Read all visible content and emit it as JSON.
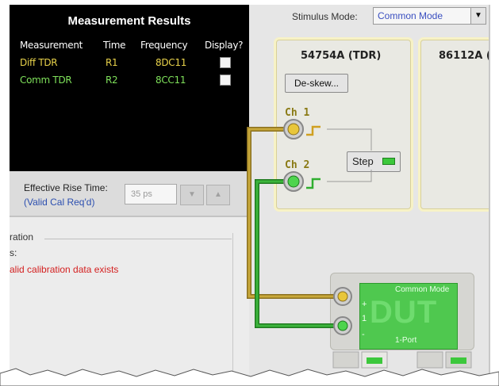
{
  "results": {
    "title": "Measurement Results",
    "headers": [
      "Measurement",
      "Time",
      "Frequency",
      "Display?"
    ],
    "rows": [
      {
        "measurement": "Diff TDR",
        "time": "R1",
        "frequency": "8DC11",
        "display": false
      },
      {
        "measurement": "Comm TDR",
        "time": "R2",
        "frequency": "8CC11",
        "display": false
      }
    ]
  },
  "rise": {
    "label": "Effective Rise Time:",
    "note": "(Valid Cal Req'd)",
    "value": "35 ps"
  },
  "calibration": {
    "title": "ration",
    "status_label": "s:",
    "message": "alid calibration data exists"
  },
  "stimulus": {
    "label": "Stimulus Mode:",
    "value": "Common Mode"
  },
  "instruments": {
    "module1": "54754A (TDR)",
    "module2": "86112A (",
    "deskew": "De-skew...",
    "ch1": "Ch 1",
    "ch2": "Ch 2",
    "step": "Step"
  },
  "dut": {
    "mode": "Common Mode",
    "name": "DUT",
    "ports": "1-Port",
    "pin_plus": "+",
    "pin_one": "1",
    "pin_minus": "-"
  },
  "colors": {
    "measurement_diff": "#e8d24a",
    "measurement_comm": "#7ee05a",
    "cable_yellow": "#c8a83a",
    "cable_green": "#3cb43c",
    "dut_green": "#4fc84f",
    "error_red": "#d42020",
    "link_blue": "#2c4fb0"
  }
}
